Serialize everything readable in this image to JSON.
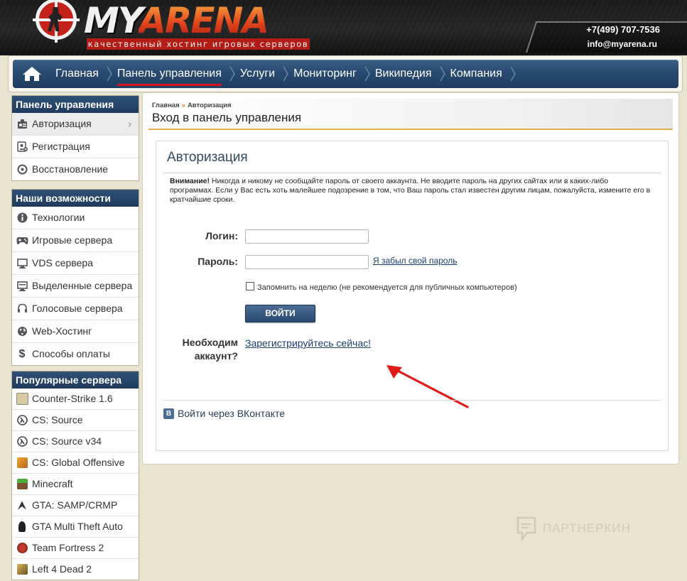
{
  "header": {
    "logo_my": "MY",
    "logo_arena": "ARENA",
    "tagline": "качественный хостинг игровых серверов",
    "phone": "+7(499) 707-7536",
    "email": "info@myarena.ru"
  },
  "nav": {
    "items": [
      {
        "label": "Главная"
      },
      {
        "label": "Панель управления"
      },
      {
        "label": "Услуги"
      },
      {
        "label": "Мониторинг"
      },
      {
        "label": "Википедия"
      },
      {
        "label": "Компания"
      }
    ]
  },
  "sidebar": {
    "panel": {
      "title": "Панель управления",
      "items": [
        {
          "label": "Авторизация",
          "icon": "id-card-icon"
        },
        {
          "label": "Регистрация",
          "icon": "user-add-icon"
        },
        {
          "label": "Восстановление",
          "icon": "restore-icon"
        }
      ]
    },
    "features": {
      "title": "Наши возможности",
      "items": [
        {
          "label": "Технологии",
          "icon": "info-icon"
        },
        {
          "label": "Игровые сервера",
          "icon": "gamepad-icon"
        },
        {
          "label": "VDS сервера",
          "icon": "monitor-icon"
        },
        {
          "label": "Выделенные сервера",
          "icon": "server-icon"
        },
        {
          "label": "Голосовые сервера",
          "icon": "headset-icon"
        },
        {
          "label": "Web-Хостинг",
          "icon": "globe-icon"
        },
        {
          "label": "Способы оплаты",
          "icon": "dollar-icon"
        }
      ]
    },
    "popular": {
      "title": "Популярные сервера",
      "items": [
        {
          "label": "Counter-Strike 1.6",
          "icon": "cs16-icon"
        },
        {
          "label": "CS: Source",
          "icon": "css-icon"
        },
        {
          "label": "CS: Source v34",
          "icon": "css34-icon"
        },
        {
          "label": "CS: Global Offensive",
          "icon": "csgo-icon"
        },
        {
          "label": "Minecraft",
          "icon": "minecraft-icon"
        },
        {
          "label": "GTA: SAMP/CRMP",
          "icon": "samp-icon"
        },
        {
          "label": "GTA Multi Theft Auto",
          "icon": "mta-icon"
        },
        {
          "label": "Team Fortress 2",
          "icon": "tf2-icon"
        },
        {
          "label": "Left 4 Dead 2",
          "icon": "l4d2-icon"
        }
      ]
    }
  },
  "main": {
    "breadcrumb": [
      "Главная",
      "Авторизация"
    ],
    "breadcrumb_sep": "»",
    "page_title": "Вход в панель управления",
    "auth": {
      "title": "Авторизация",
      "warning_bold": "Внимание!",
      "warning_text": " Никогда и никому не сообщайте пароль от своего аккаунта. Не вводите пароль на других сайтах или в каких-либо программах. Если у Вас есть хоть малейшее подозрение в том, что Ваш пароль стал известен другим лицам, пожалуйста, измените его в кратчайшие сроки.",
      "login_label": "Логин:",
      "login_value": "",
      "password_label": "Пароль:",
      "password_value": "",
      "forgot_link": "Я забыл свой пароль",
      "remember_label": "Запомнить на неделю (не рекомендуется для публичных компьютеров)",
      "login_button": "ВОЙТИ",
      "need_account": "Необходим аккаунт?",
      "register_link": "Зарегистрируйтесь сейчас!",
      "vk_badge": "B",
      "vk_login": "Войти через ВКонтакте"
    }
  },
  "watermark": "ПАРТНЕРКИН",
  "colors": {
    "nav_bg": "#294a70",
    "accent_red": "#d6131b",
    "link": "#1b3f6e",
    "gold_rule": "#e1b14a"
  }
}
